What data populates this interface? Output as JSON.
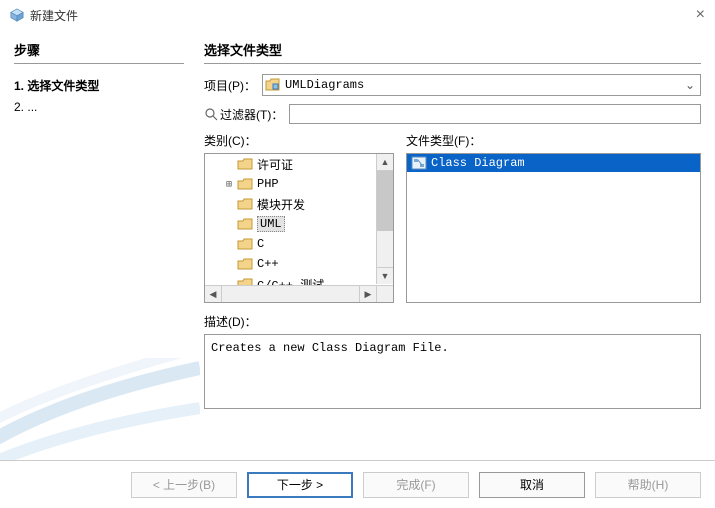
{
  "window": {
    "title": "新建文件"
  },
  "steps": {
    "heading": "步骤",
    "items": [
      {
        "num": "1.",
        "label": "选择文件类型",
        "current": true
      },
      {
        "num": "2.",
        "label": "...",
        "current": false
      }
    ]
  },
  "main": {
    "heading": "选择文件类型",
    "project_label": "项目(P)：",
    "project_value": "UMLDiagrams",
    "filter_label": "过滤器(T)：",
    "filter_value": "",
    "category_label": "类别(C)：",
    "categories": [
      {
        "label": "许可证",
        "expandable": false
      },
      {
        "label": "PHP",
        "expandable": true
      },
      {
        "label": "模块开发",
        "expandable": false
      },
      {
        "label": "UML",
        "expandable": false,
        "selected": true
      },
      {
        "label": "C",
        "expandable": false
      },
      {
        "label": "C++",
        "expandable": false
      },
      {
        "label": "C/C++ 测试",
        "expandable": false
      }
    ],
    "filetype_label": "文件类型(F)：",
    "filetypes": [
      {
        "label": "Class Diagram",
        "selected": true
      }
    ],
    "desc_label": "描述(D)：",
    "desc_text": "Creates a new Class Diagram File."
  },
  "buttons": {
    "back": "< 上一步(B)",
    "next": "下一步 >",
    "finish": "完成(F)",
    "cancel": "取消",
    "help": "帮助(H)"
  }
}
